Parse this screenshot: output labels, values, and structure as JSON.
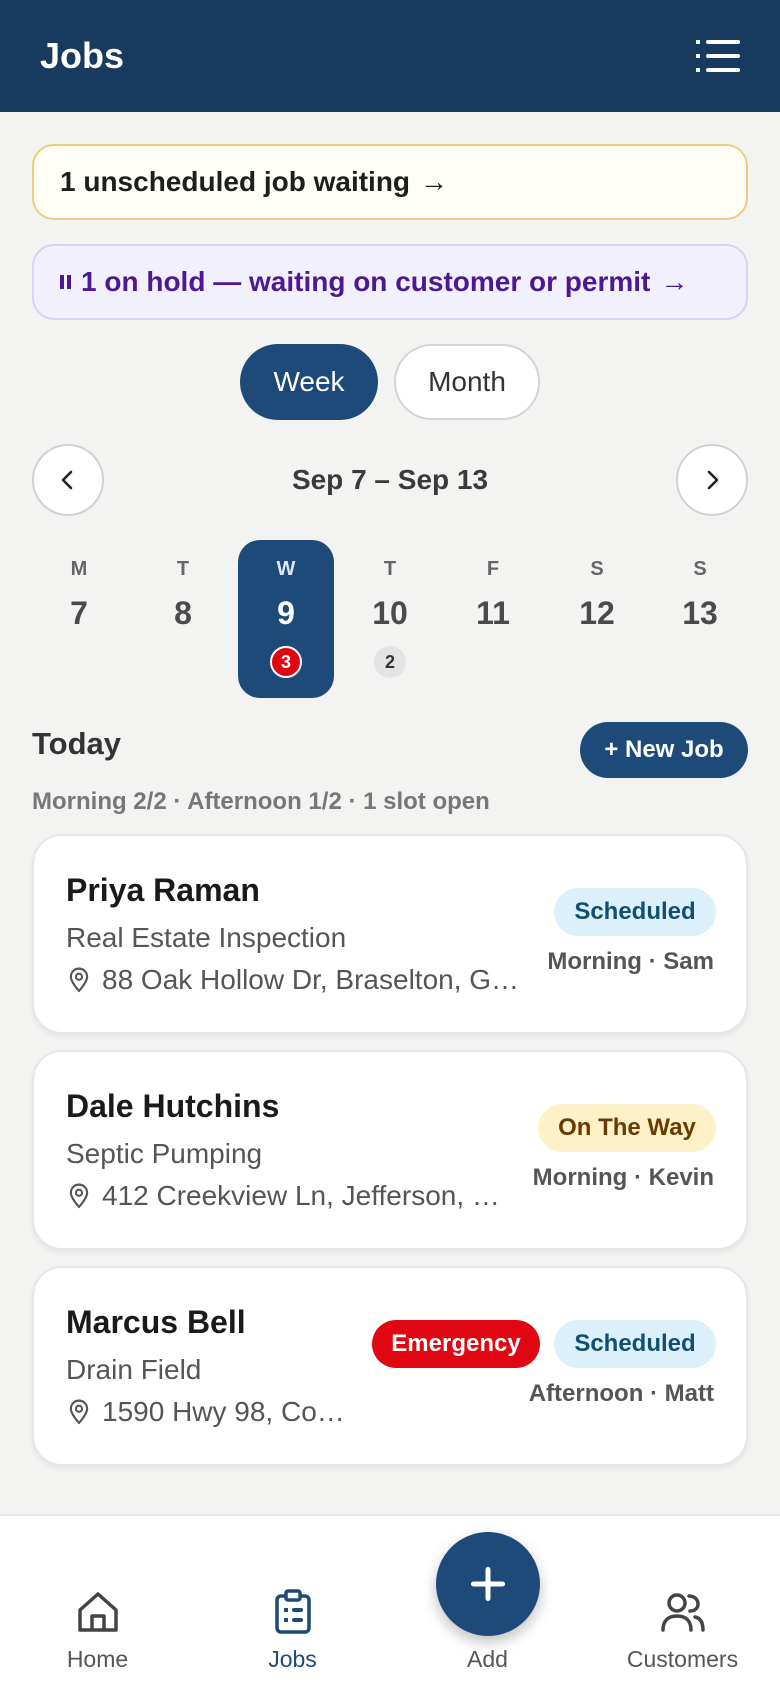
{
  "header": {
    "title": "Jobs",
    "menu_icon": "list-menu-icon"
  },
  "banners": {
    "unscheduled": {
      "text": "1 unscheduled job waiting",
      "arrow": "→"
    },
    "on_hold": {
      "text": "1 on hold — waiting on customer or permit",
      "arrow": "→"
    }
  },
  "view_toggle": {
    "week_label": "Week",
    "month_label": "Month",
    "selected": "Week"
  },
  "week_nav": {
    "range": "Sep 7 – Sep 13"
  },
  "days": [
    {
      "letter": "M",
      "num": "7",
      "badge": ""
    },
    {
      "letter": "T",
      "num": "8",
      "badge": ""
    },
    {
      "letter": "W",
      "num": "9",
      "badge": "3"
    },
    {
      "letter": "T",
      "num": "10",
      "badge": "2"
    },
    {
      "letter": "F",
      "num": "11",
      "badge": ""
    },
    {
      "letter": "S",
      "num": "12",
      "badge": ""
    },
    {
      "letter": "S",
      "num": "13",
      "badge": ""
    }
  ],
  "today": {
    "title": "Today",
    "new_job_label": "+ New Job",
    "capacity": "Morning 2/2 · Afternoon 1/2 · 1 slot open"
  },
  "jobs": [
    {
      "name": "Priya Raman",
      "service": "Real Estate Inspection",
      "address": "88 Oak Hollow Dr, Braselton, G…",
      "status": "Scheduled",
      "slot": "Morning · Sam"
    },
    {
      "name": "Dale Hutchins",
      "service": "Septic Pumping",
      "address": "412 Creekview Ln, Jefferson, …",
      "status": "On The Way",
      "slot": "Morning · Kevin"
    },
    {
      "name": "Marcus Bell",
      "service": "Drain Field",
      "address": "1590 Hwy 98, Co…",
      "priority": "Emergency",
      "status": "Scheduled",
      "slot": "Afternoon · Matt"
    }
  ],
  "bottom_nav": {
    "home_label": "Home",
    "jobs_label": "Jobs",
    "add_label": "Add",
    "customers_label": "Customers",
    "active": "Jobs"
  },
  "colors": {
    "primary": "#1d4a78",
    "header": "#173a5e",
    "emergency": "#e00712",
    "scheduled_bg": "#dcf0fb",
    "on_the_way_bg": "#fcf1c7",
    "hold_text": "#4b1a8f"
  }
}
